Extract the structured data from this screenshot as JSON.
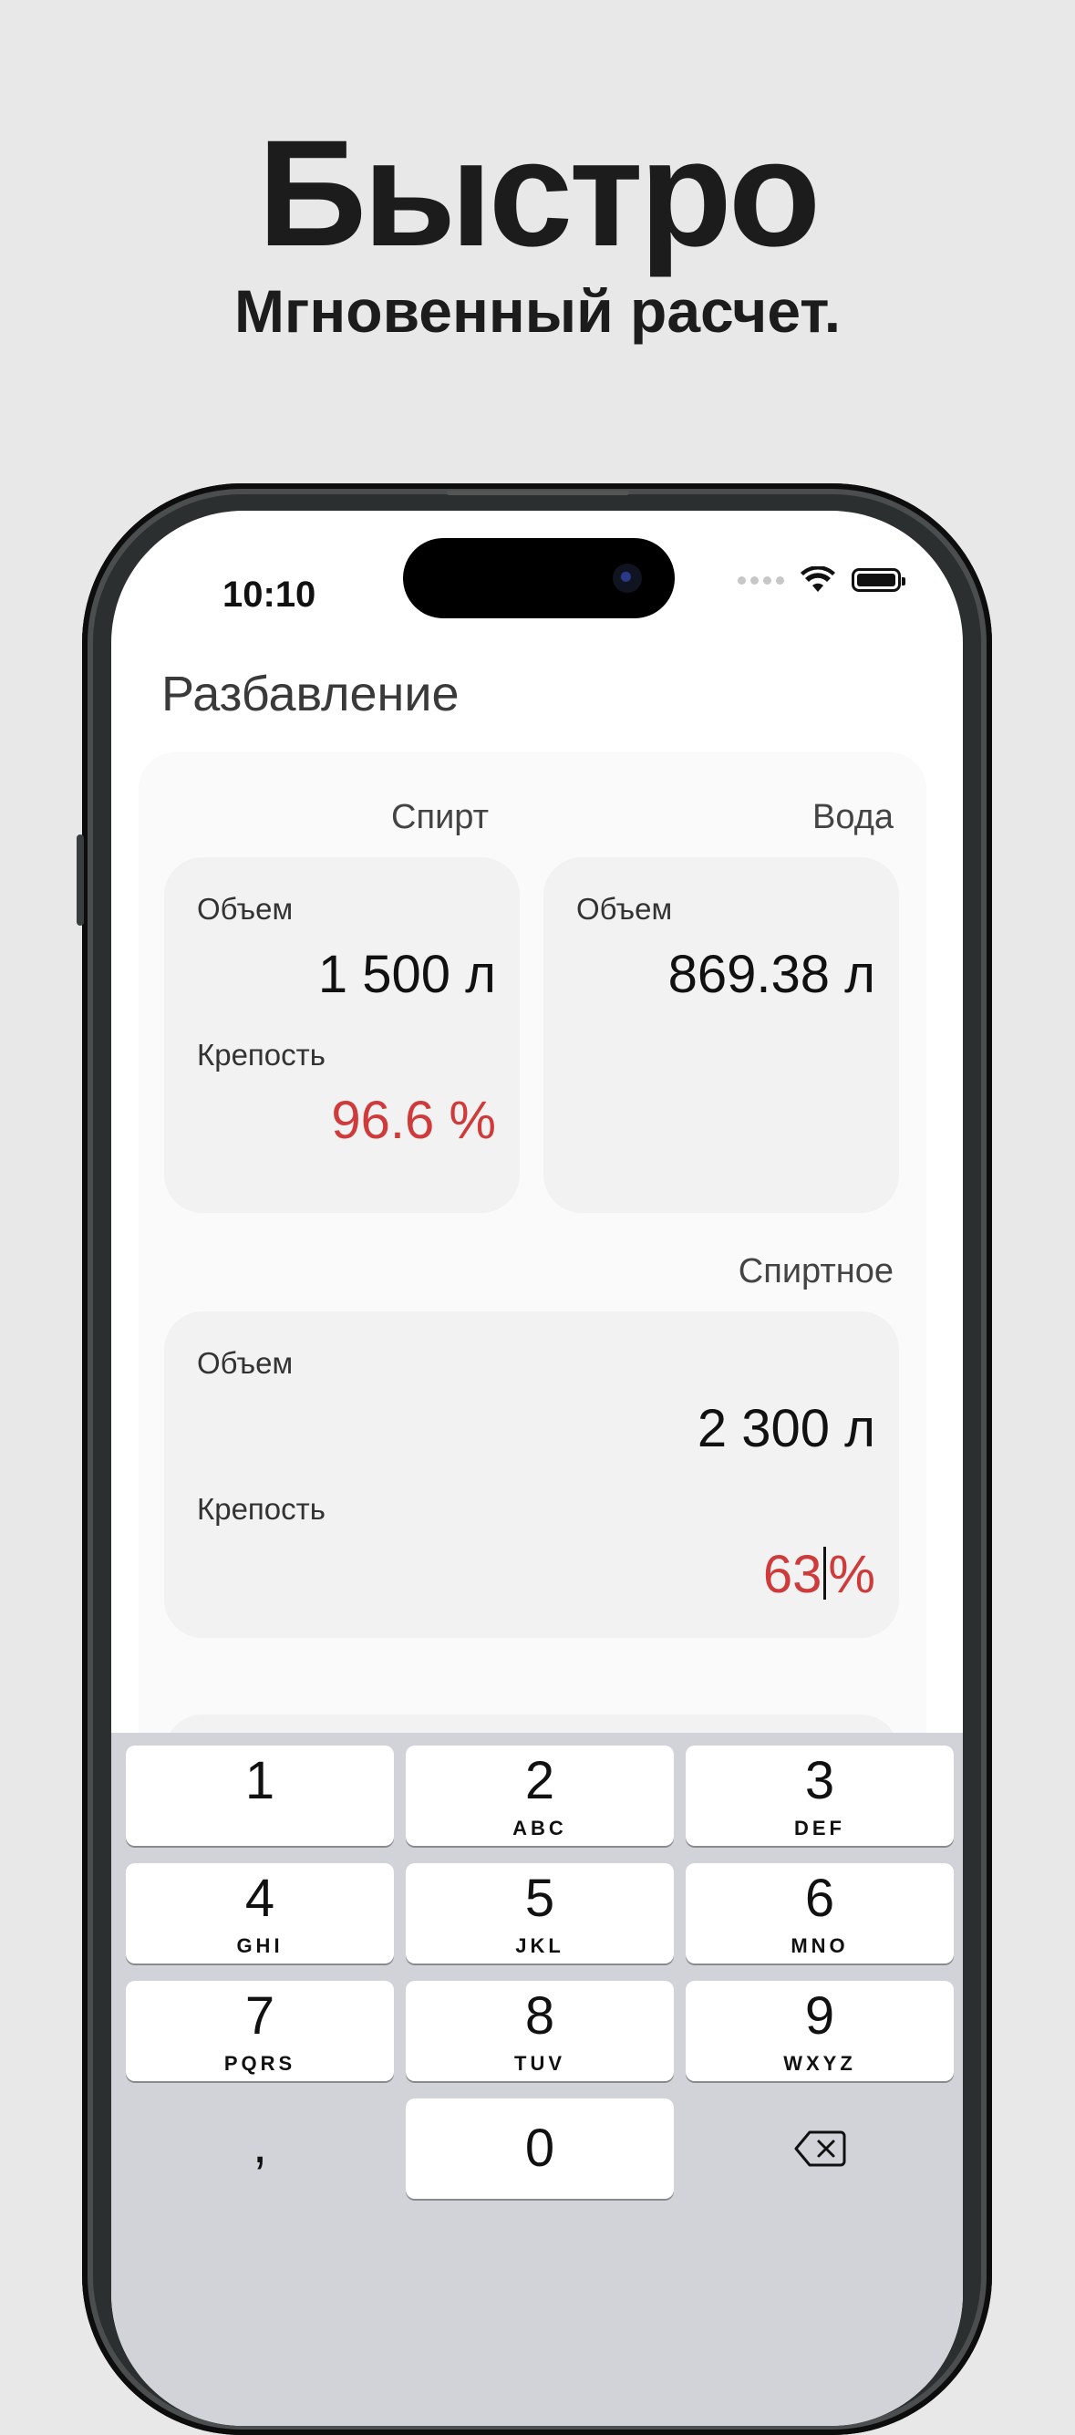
{
  "promo": {
    "headline": "Быстро",
    "subheadline": "Мгновенный расчет."
  },
  "status_bar": {
    "time": "10:10"
  },
  "app": {
    "title": "Разбавление",
    "spirit": {
      "section_label": "Спирт",
      "volume_label": "Объем",
      "volume_value": "1 500 л",
      "strength_label": "Крепость",
      "strength_value": "96.6 %"
    },
    "water": {
      "section_label": "Вода",
      "volume_label": "Объем",
      "volume_value": "869.38 л"
    },
    "drink": {
      "section_label": "Спиртное",
      "volume_label": "Объем",
      "volume_value": "2 300 л",
      "strength_label": "Крепость",
      "strength_input": "63",
      "strength_unit": "%"
    }
  },
  "keyboard": {
    "keys": [
      {
        "num": "1",
        "letters": ""
      },
      {
        "num": "2",
        "letters": "ABC"
      },
      {
        "num": "3",
        "letters": "DEF"
      },
      {
        "num": "4",
        "letters": "GHI"
      },
      {
        "num": "5",
        "letters": "JKL"
      },
      {
        "num": "6",
        "letters": "MNO"
      },
      {
        "num": "7",
        "letters": "PQRS"
      },
      {
        "num": "8",
        "letters": "TUV"
      },
      {
        "num": "9",
        "letters": "WXYZ"
      },
      {
        "num": "0",
        "letters": ""
      }
    ],
    "comma": ",",
    "delete_icon": "backspace-icon"
  },
  "colors": {
    "accent_red": "#cf3a3a",
    "keyboard_bg": "#d1d3d9",
    "page_bg": "#e8e8e8"
  }
}
